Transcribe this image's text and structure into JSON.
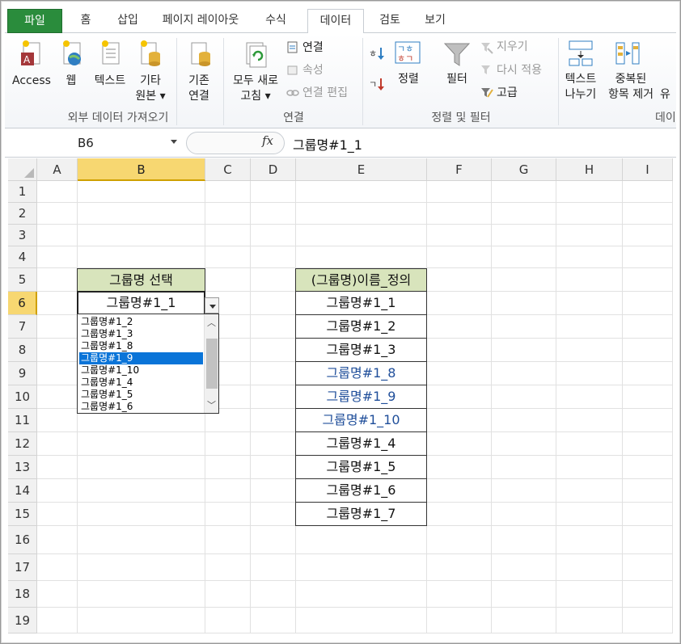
{
  "tabs": [
    "파일",
    "홈",
    "삽입",
    "페이지 레이아웃",
    "수식",
    "데이터",
    "검토",
    "보기"
  ],
  "ribbon": {
    "external": {
      "access": "Access",
      "web": "웹",
      "text": "텍스트",
      "other_line1": "기타",
      "other_line2": "원본 ▾",
      "existing_line1": "기존",
      "existing_line2": "연결",
      "group": "외부 데이터 가져오기"
    },
    "connections": {
      "refresh_line1": "모두 새로",
      "refresh_line2": "고침 ▾",
      "connections": "연결",
      "properties": "속성",
      "edit_links": "연결 편집",
      "group": "연결"
    },
    "sort_filter": {
      "sort": "정렬",
      "filter": "필터",
      "clear": "지우기",
      "reapply": "다시 적용",
      "advanced": "고급",
      "group": "정렬 및 필터"
    },
    "data_tools": {
      "text_to_cols_line1": "텍스트",
      "text_to_cols_line2": "나누기",
      "dup_line1": "중복된",
      "dup_line2": "항목 제거",
      "more": "유",
      "group": "데이"
    }
  },
  "formula_bar": {
    "name_box": "B6",
    "fx": "fx",
    "formula": "그룹명#1_1"
  },
  "columns": [
    "A",
    "B",
    "C",
    "D",
    "E",
    "F",
    "G",
    "H",
    "I"
  ],
  "rows": [
    "1",
    "2",
    "3",
    "4",
    "5",
    "6",
    "7",
    "8",
    "9",
    "10",
    "11",
    "12",
    "13",
    "14",
    "15",
    "16",
    "17",
    "18",
    "19"
  ],
  "cells": {
    "b5": "그룹명 선택",
    "b6": "그룹명#1_1",
    "e5": "(그룹명)이름_정의",
    "e_values": [
      "그룹명#1_1",
      "그룹명#1_2",
      "그룹명#1_3",
      "그룹명#1_8",
      "그룹명#1_9",
      "그룹명#1_10",
      "그룹명#1_4",
      "그룹명#1_5",
      "그룹명#1_6",
      "그룹명#1_7"
    ]
  },
  "dropdown": {
    "items": [
      "그룹명#1_2",
      "그룹명#1_3",
      "그룹명#1_8",
      "그룹명#1_9",
      "그룹명#1_10",
      "그룹명#1_4",
      "그룹명#1_5",
      "그룹명#1_6"
    ],
    "highlighted_index": 3
  },
  "colors": {
    "file_tab": "#2a8c3c",
    "header_fill": "#d8e4bc",
    "selected_header": "#f7d771",
    "highlight": "#0a74d8",
    "blue_text": "#1f4e9a"
  }
}
